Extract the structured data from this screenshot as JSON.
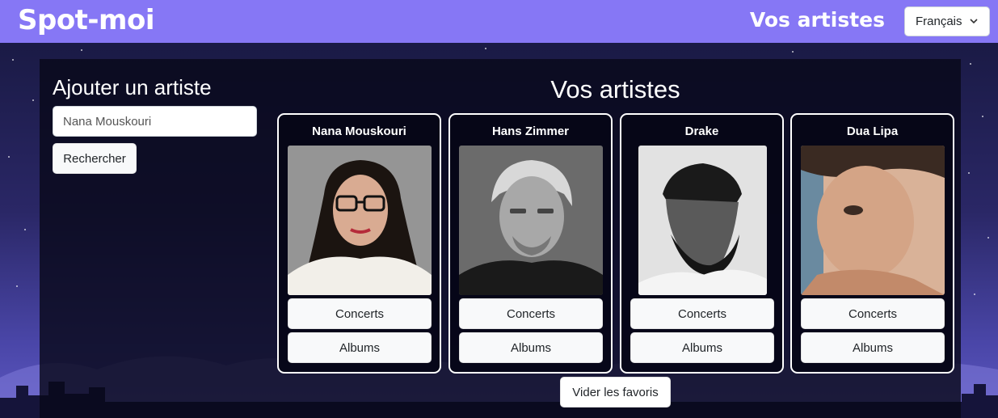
{
  "navbar": {
    "brand": "Spot-moi",
    "nav_link": "Vos artistes",
    "language": {
      "selected": "Français",
      "icon": "chevron-down-icon"
    },
    "color": "#8677f5"
  },
  "sidebar": {
    "title": "Ajouter un artiste",
    "search_value": "Nana Mouskouri",
    "search_button": "Rechercher"
  },
  "main": {
    "title": "Vos artistes",
    "artists": [
      {
        "name": "Nana Mouskouri",
        "concerts_label": "Concerts",
        "albums_label": "Albums"
      },
      {
        "name": "Hans Zimmer",
        "concerts_label": "Concerts",
        "albums_label": "Albums"
      },
      {
        "name": "Drake",
        "concerts_label": "Concerts",
        "albums_label": "Albums"
      },
      {
        "name": "Dua Lipa",
        "concerts_label": "Concerts",
        "albums_label": "Albums"
      }
    ],
    "clear_button": "Vider les favoris"
  }
}
